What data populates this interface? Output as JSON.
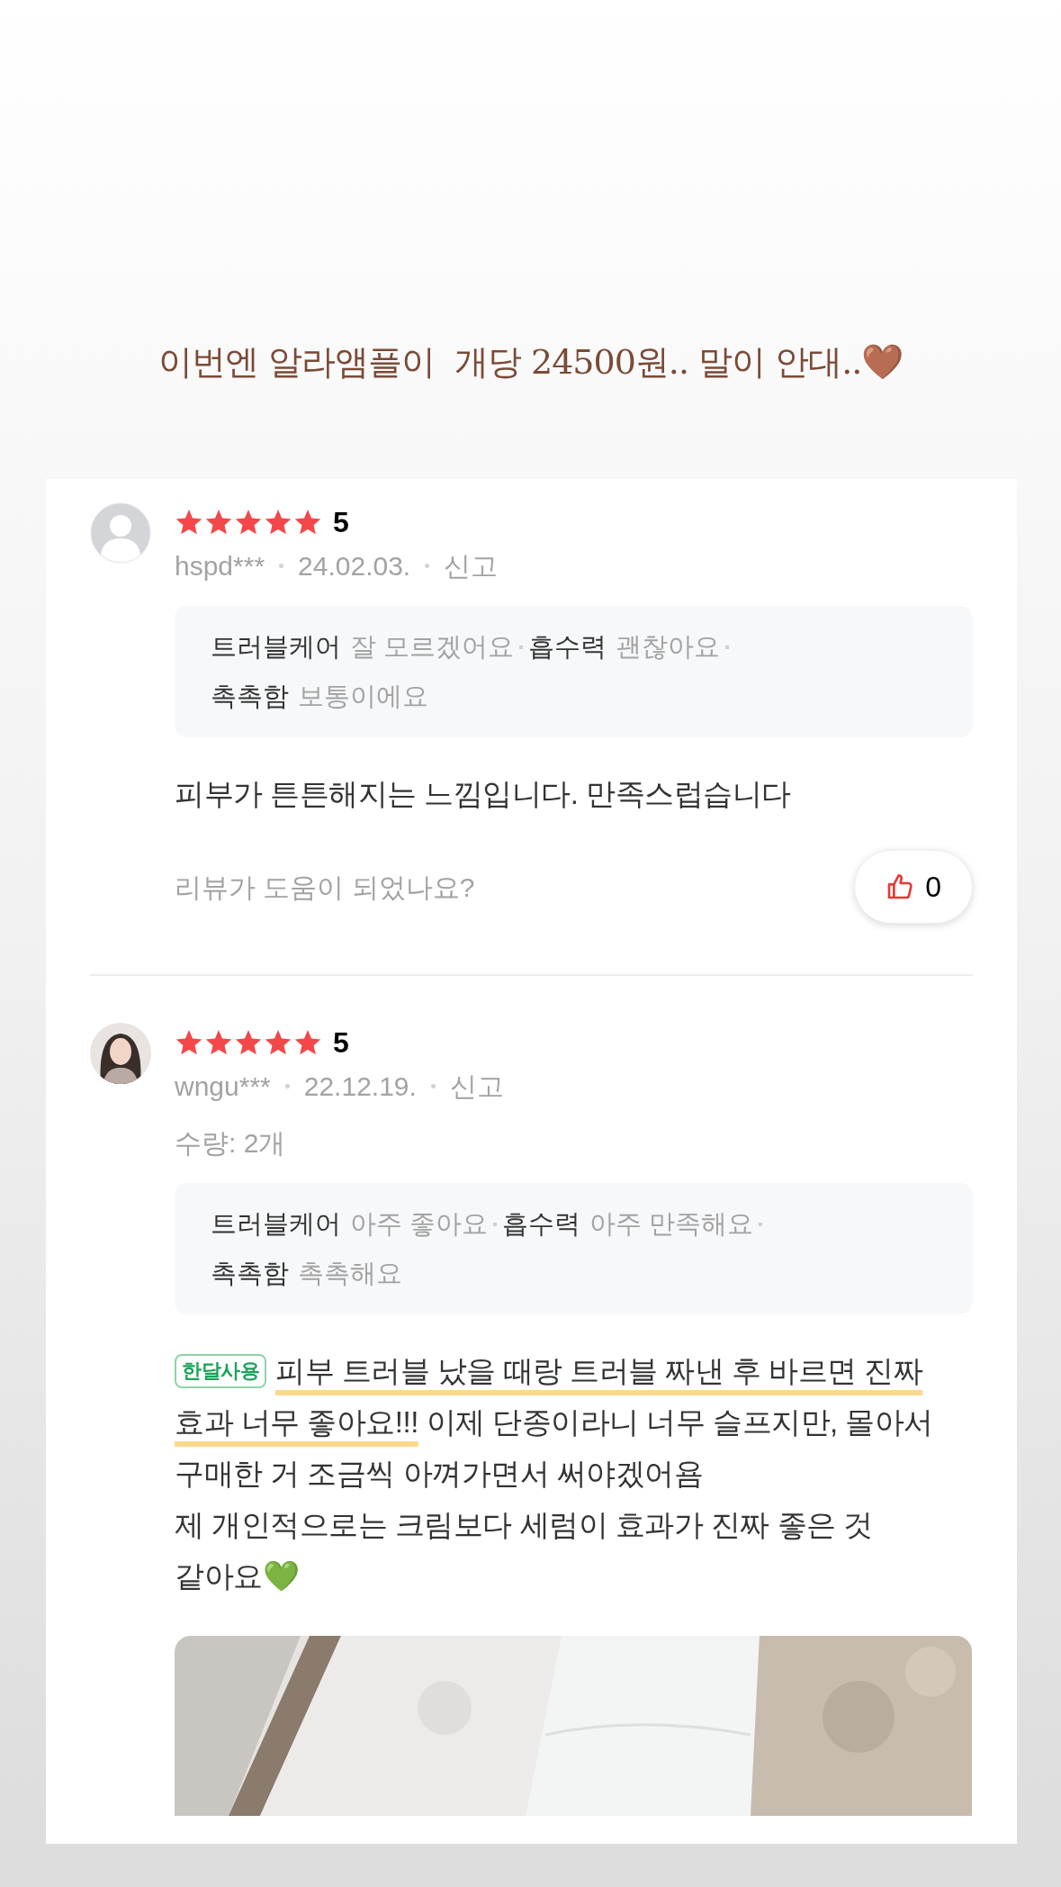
{
  "caption": "이번엔 알라앰플이  개당 24500원.. 말이 안대..🤎",
  "reviews": [
    {
      "avatar": {
        "kind": "default"
      },
      "stars": 5,
      "rating": "5",
      "user": "hspd***",
      "date": "24.02.03.",
      "report": "신고",
      "attributes": [
        {
          "name": "트러블케어",
          "value": "잘 모르겠어요"
        },
        {
          "name": "흡수력",
          "value": "괜찮아요"
        },
        {
          "name": "촉촉함",
          "value": "보통이에요"
        }
      ],
      "body": [
        {
          "text": "피부가 튼튼해지는 느낌입니다. 만족스럽습니다"
        }
      ],
      "helpful": {
        "question": "리뷰가 도움이 되었나요?",
        "count": "0"
      }
    },
    {
      "stars": 5,
      "rating": "5",
      "user": "wngu***",
      "date": "22.12.19.",
      "report": "신고",
      "quantity": "수량: 2개",
      "attributes": [
        {
          "name": "트러블케어",
          "value": "아주 좋아요"
        },
        {
          "name": "흡수력",
          "value": "아주 만족해요"
        },
        {
          "name": "촉촉함",
          "value": "촉촉해요"
        }
      ],
      "badge": "한달사용",
      "body": [
        {
          "text": "피부 트러블 났을 때랑 트러블 짜낸 후 바르면 진짜 효과 너무 좋아요!!!",
          "highlighted": true
        },
        {
          "text": " 이제 단종이라니 너무 슬프지만, 몰아서 구매한 거 조금씩 아껴가면서 써야겠어욤\n제 개인적으로는 크림보다 세럼이 효과가 진짜 좋은 것 같아요💚",
          "highlighted": false
        }
      ]
    }
  ]
}
